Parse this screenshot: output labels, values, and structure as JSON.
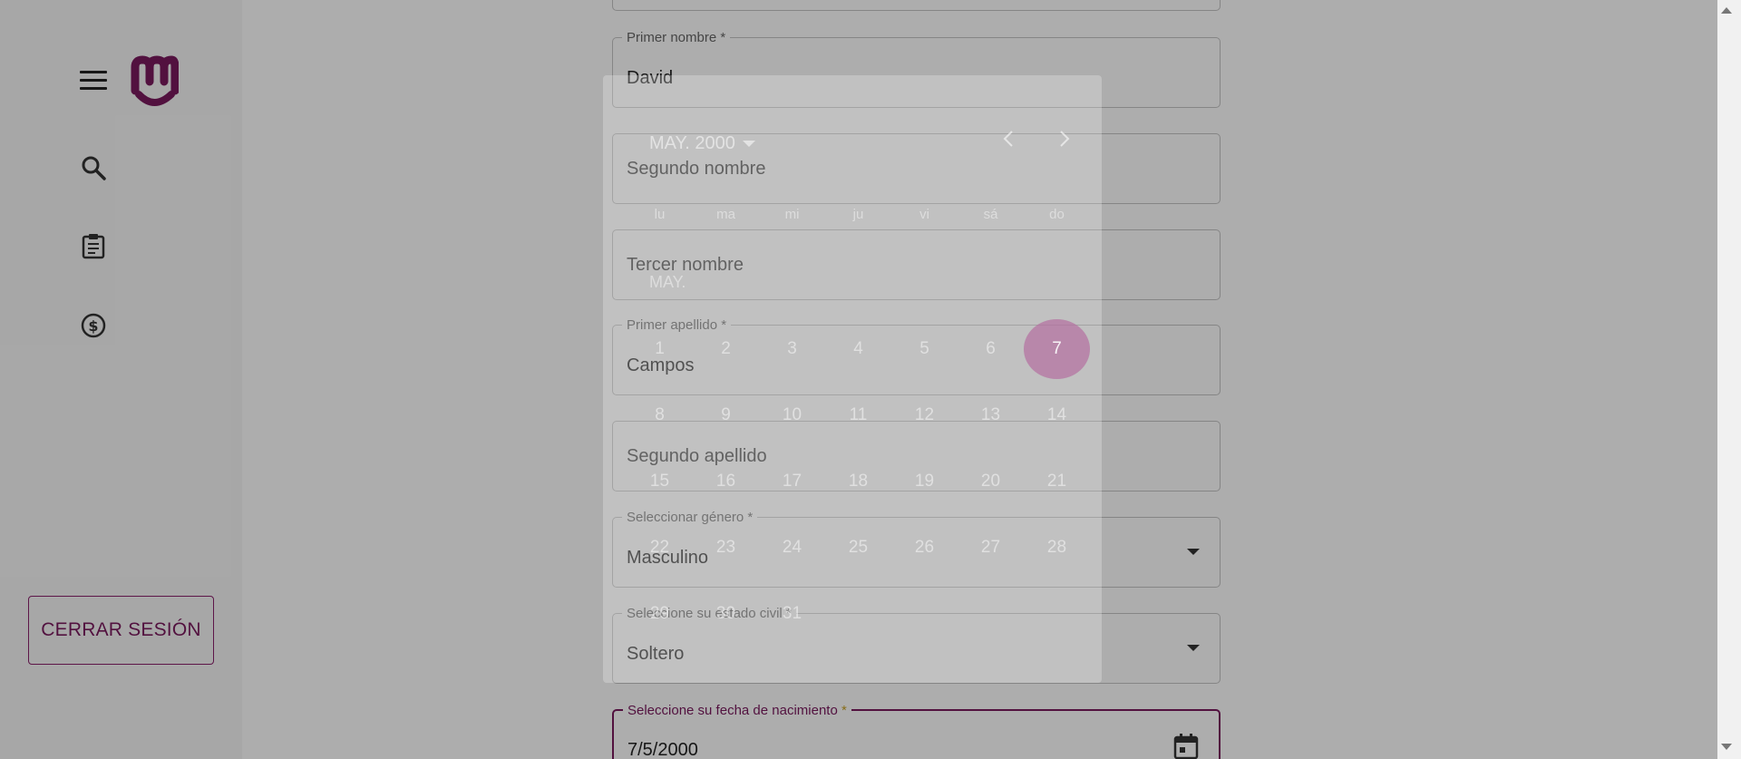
{
  "sidebar": {
    "menu_icon": "hamburger-menu-icon",
    "logo_icon": "brand-logo-icon",
    "items": [
      {
        "icon": "search-icon"
      },
      {
        "icon": "clipboard-icon"
      },
      {
        "icon": "dollar-circle-icon"
      }
    ],
    "logout_label": "CERRAR SESIÓN"
  },
  "form": {
    "first_name": {
      "label": "Primer nombre *",
      "value": "David"
    },
    "second_name": {
      "placeholder": "Segundo nombre"
    },
    "third_name": {
      "placeholder": "Tercer nombre"
    },
    "first_surname": {
      "label": "Primer apellido *",
      "value": "Campos"
    },
    "second_surname": {
      "placeholder": "Segundo apellido"
    },
    "gender": {
      "label": "Seleccionar género *",
      "value": "Masculino"
    },
    "civil_status": {
      "label": "Seleccione su estado civil *",
      "value": "Soltero"
    },
    "birthdate": {
      "label": "Seleccione su fecha de nacimiento",
      "required_mark": "*",
      "value": "7/5/2000"
    }
  },
  "datepicker": {
    "period": "MAY. 2000",
    "month_tag": "MAY.",
    "weekdays": [
      "lu",
      "ma",
      "mi",
      "ju",
      "vi",
      "sá",
      "do"
    ],
    "weeks": [
      [
        "1",
        "2",
        "3",
        "4",
        "5",
        "6",
        "7"
      ],
      [
        "8",
        "9",
        "10",
        "11",
        "12",
        "13",
        "14"
      ],
      [
        "15",
        "16",
        "17",
        "18",
        "19",
        "20",
        "21"
      ],
      [
        "22",
        "23",
        "24",
        "25",
        "26",
        "27",
        "28"
      ],
      [
        "29",
        "30",
        "31",
        "",
        "",
        "",
        ""
      ]
    ],
    "selected": "7"
  },
  "colors": {
    "brand": "#7a1a5e",
    "required": "#c9a227"
  }
}
